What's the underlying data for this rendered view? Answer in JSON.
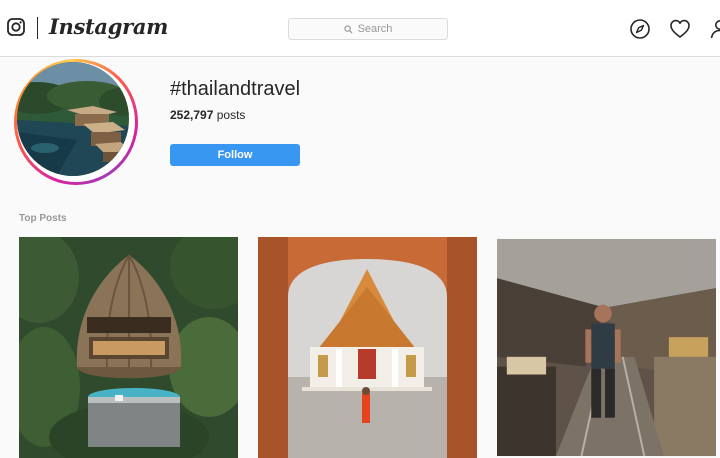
{
  "header": {
    "brand": "Instagram",
    "search": {
      "placeholder": "Search"
    },
    "icons": [
      "instagram-glyph-icon",
      "search-icon",
      "explore-compass-icon",
      "activity-heart-icon",
      "profile-person-icon"
    ]
  },
  "tag": {
    "name": "#thailandtravel",
    "post_count": "252,797",
    "post_suffix": " posts",
    "follow_label": "Follow"
  },
  "top_posts": {
    "title": "Top Posts",
    "items": [
      {
        "subject": "treehouse-pod-villa"
      },
      {
        "subject": "marble-temple-monk"
      },
      {
        "subject": "railway-market-man"
      }
    ]
  },
  "colors": {
    "accent": "#3897f0",
    "border": "#dbdbdb",
    "background": "#fafafa",
    "muted_text": "#999999",
    "text": "#262626"
  }
}
